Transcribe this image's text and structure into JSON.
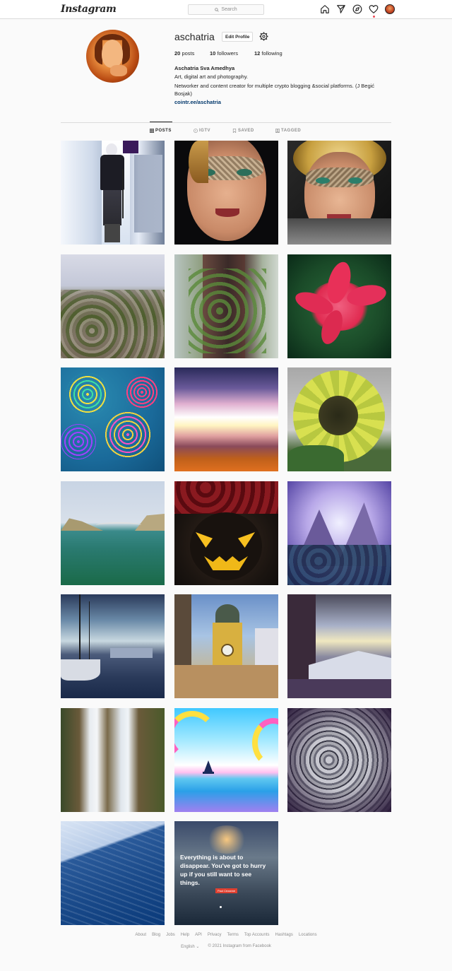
{
  "nav": {
    "logo": "Instagram",
    "search_placeholder": "Search",
    "icons": [
      "home-icon",
      "direct-icon",
      "explore-icon",
      "activity-icon",
      "profile-avatar"
    ]
  },
  "profile": {
    "username": "aschatria",
    "edit_label": "Edit Profile",
    "posts_count": "20",
    "posts_label": "posts",
    "followers_count": "10",
    "followers_label": "followers",
    "following_count": "12",
    "following_label": "following",
    "full_name": "Aschatria Sva Amedhya",
    "bio_line1": "Art, digital art and photography.",
    "bio_line2": "Networker and content creator for multiple crypto blogging &social platforms. (J Begić Bosjak)",
    "link": "cointr.ee/aschatria"
  },
  "tabs": [
    {
      "label": "POSTS",
      "icon": "grid-icon",
      "active": true
    },
    {
      "label": "IGTV",
      "icon": "igtv-icon",
      "active": false
    },
    {
      "label": "SAVED",
      "icon": "bookmark-icon",
      "active": false
    },
    {
      "label": "TAGGED",
      "icon": "tagged-icon",
      "active": false
    }
  ],
  "posts": [
    {
      "subject": "digital art figure"
    },
    {
      "subject": "masked fantasy face"
    },
    {
      "subject": "masked blonde face"
    },
    {
      "subject": "rocky hillside"
    },
    {
      "subject": "ivy on tree trunk"
    },
    {
      "subject": "pink lily"
    },
    {
      "subject": "colorful circles"
    },
    {
      "subject": "glowing sunset stripes"
    },
    {
      "subject": "sunflower"
    },
    {
      "subject": "bridge over sea"
    },
    {
      "subject": "jack-o-lantern with roses"
    },
    {
      "subject": "fantasy mountains"
    },
    {
      "subject": "sailboat harbor"
    },
    {
      "subject": "clock tower"
    },
    {
      "subject": "harbor with yachts"
    },
    {
      "subject": "waterfall"
    },
    {
      "subject": "rainbow sailboat"
    },
    {
      "subject": "pebbles"
    },
    {
      "subject": "blue sea waves"
    },
    {
      "subject": "quote image",
      "quote": "Everything is about to disappear. You've got to hurry up if you still want to see things.",
      "author": "Paul Cézanne"
    }
  ],
  "footer": {
    "links": [
      "About",
      "Blog",
      "Jobs",
      "Help",
      "API",
      "Privacy",
      "Terms",
      "Top Accounts",
      "Hashtags",
      "Locations"
    ],
    "language": "English",
    "copyright": "© 2021 Instagram from Facebook"
  },
  "colors": {
    "link": "#00376b",
    "border": "#dbdbdb",
    "muted": "#8e8e8e",
    "notification": "#ed4956"
  }
}
